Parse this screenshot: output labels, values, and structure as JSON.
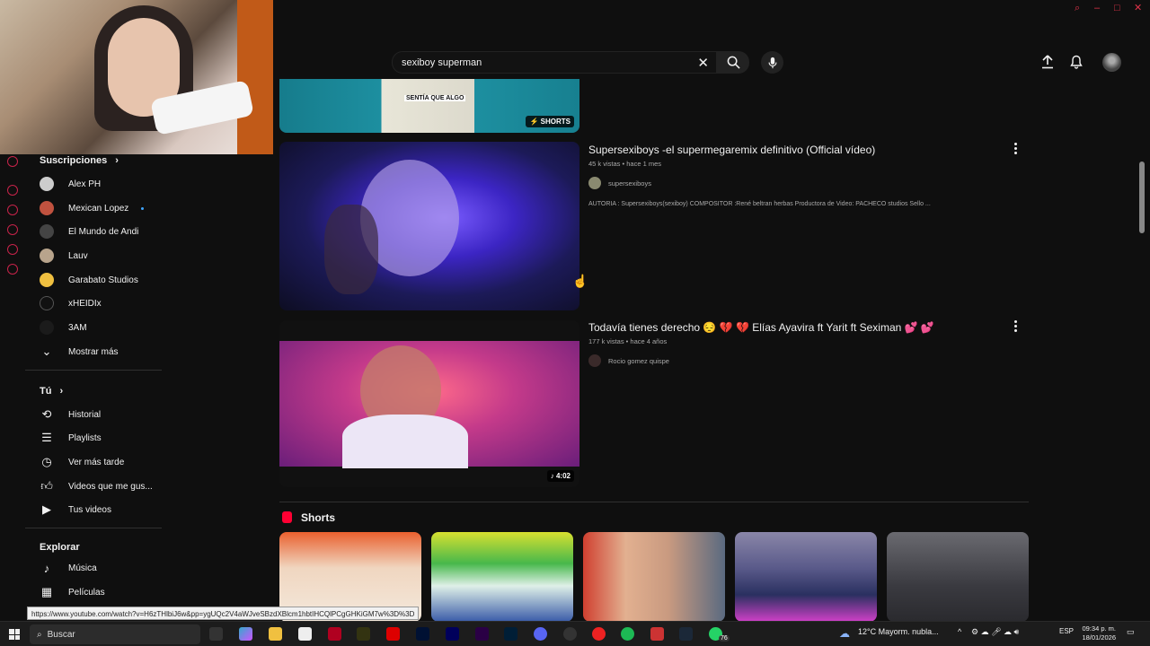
{
  "search": {
    "value": "sexiboy superman"
  },
  "sidebar": {
    "subscriptions_label": "Suscripciones",
    "subscriptions": [
      {
        "label": "Alex PH",
        "live": false
      },
      {
        "label": "Mexican Lopez",
        "live": true
      },
      {
        "label": "El Mundo de Andi",
        "live": false
      },
      {
        "label": "Lauv",
        "live": false
      },
      {
        "label": "Garabato Studios",
        "live": false
      },
      {
        "label": "xHEIDIx",
        "live": false
      },
      {
        "label": "3AM",
        "live": false
      }
    ],
    "show_more": "Mostrar más",
    "you_label": "Tú",
    "you_items": [
      "Historial",
      "Playlists",
      "Ver más tarde",
      "Videos que me gus...",
      "Tus videos"
    ],
    "explore_label": "Explorar",
    "explore_items": [
      "Música",
      "Películas"
    ]
  },
  "results": {
    "partial_thumb": {
      "caption": "SENTÍA QUE ALGO",
      "badge": "SHORTS"
    },
    "videos": [
      {
        "title": "Supersexiboys -el supermegaremix definitivo (Official vídeo)",
        "meta": "45 k vistas • hace 1 mes",
        "channel": "supersexiboys",
        "description": "AUTORIA : Supersexiboys(sexiboy) COMPOSITOR :René beltran herbas Productora de Video: PACHECO studios Sello ..."
      },
      {
        "title": "Todavía tienes derecho 😔 💔 💔  Elías Ayavira ft Yarit ft Seximan 💕 💕",
        "meta": "177 k vistas • hace 4 años",
        "channel": "Rocio gomez quispe",
        "duration": "4:02"
      }
    ],
    "shorts_label": "Shorts"
  },
  "status_url": "https://www.youtube.com/watch?v=H6zTHlbiJ6w&pp=ygUQc2V4aWJveSBzdXBlcm1hbtIHCQlPCgGHKiGM7w%3D%3D",
  "taskbar": {
    "search_label": "Buscar",
    "weather": "12°C  Mayorm. nubla...",
    "lang": "ESP",
    "time": "09:34 p. m.",
    "date": "18/01/2026",
    "whatsapp_badge": "76"
  },
  "colors": {
    "brand_red": "#ff0033",
    "background": "#0f0f0f"
  }
}
